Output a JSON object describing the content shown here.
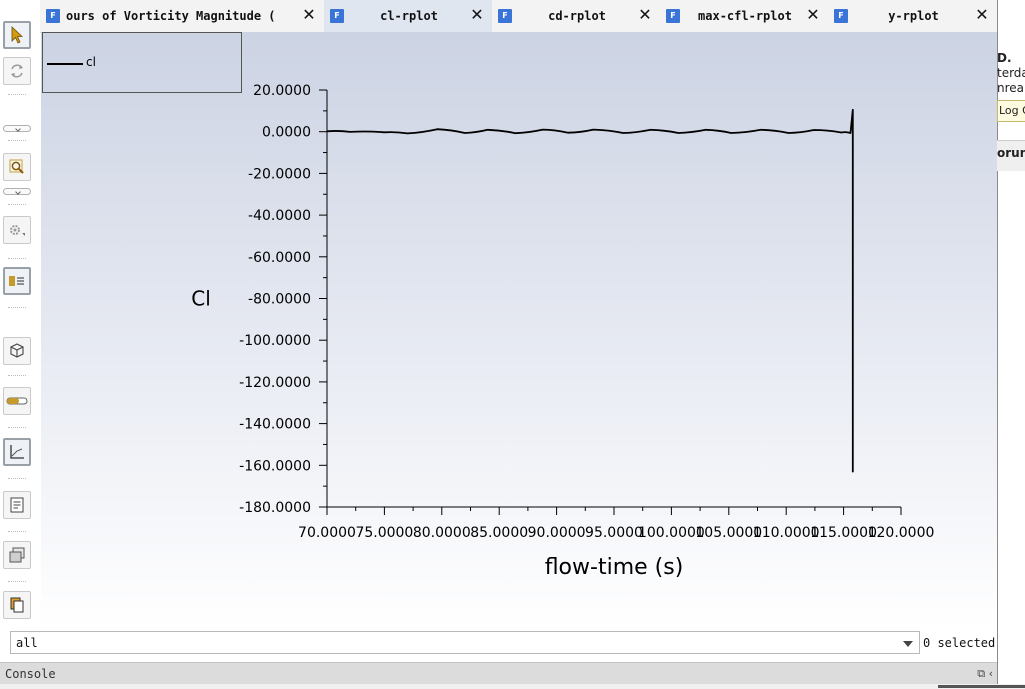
{
  "tabs": [
    {
      "label": "ours of Vorticity Magnitude (",
      "icon": "fluent-file-icon",
      "active": false
    },
    {
      "label": "cl-rplot",
      "icon": "fluent-file-icon",
      "active": true
    },
    {
      "label": "cd-rplot",
      "icon": "fluent-file-icon",
      "active": false
    },
    {
      "label": "max-cfl-rplot",
      "icon": "fluent-file-icon",
      "active": false
    },
    {
      "label": "y-rplot",
      "icon": "fluent-file-icon",
      "active": false
    }
  ],
  "tab_icon_letter": "F",
  "close_glyph": "✕",
  "toolbar": [
    "pointer-icon",
    "rotate-icon",
    "zoom-icon",
    "settings-icon",
    "legend-icon",
    "cube-icon",
    "slider-icon",
    "axes-icon",
    "report-icon",
    "view-icon",
    "copy-icon"
  ],
  "legend": {
    "label": "cl"
  },
  "chart_data": {
    "type": "line",
    "xlabel": "flow-time (s)",
    "ylabel": "Cl",
    "xlim": [
      70,
      120
    ],
    "ylim": [
      -180,
      20
    ],
    "x_ticks": [
      "70.0000",
      "75.0000",
      "80.0000",
      "85.0000",
      "90.0000",
      "95.0000",
      "100.0000",
      "105.0000",
      "110.0000",
      "115.0000",
      "120.0000"
    ],
    "y_ticks": [
      "20.0000",
      "0.0000",
      "-20.0000",
      "-40.0000",
      "-60.0000",
      "-80.0000",
      "-100.0000",
      "-120.0000",
      "-140.0000",
      "-160.0000",
      "-180.0000"
    ],
    "series": [
      {
        "name": "cl",
        "color": "#000000",
        "x": [
          70,
          72,
          75,
          77,
          79.6,
          82,
          84,
          86.4,
          88.8,
          91,
          93.2,
          95.8,
          98.2,
          100.6,
          103,
          105.2,
          107.8,
          110.2,
          112.4,
          114.8,
          115.6,
          115.8,
          115.8,
          115.8
        ],
        "y": [
          0.2,
          -0.1,
          -0.3,
          -0.8,
          1.2,
          -0.6,
          0.9,
          -0.7,
          1.0,
          -0.5,
          1.0,
          -0.6,
          0.9,
          -0.6,
          0.9,
          -0.6,
          0.9,
          -0.6,
          0.8,
          -0.4,
          -0.6,
          10.5,
          -163,
          -0.5
        ]
      }
    ]
  },
  "right_panel": {
    "lines": [
      "D.",
      "terda",
      "nrea",
      "orun"
    ],
    "log_label": "Log O"
  },
  "filter": {
    "value": "all",
    "selected": "0 selected"
  },
  "console": {
    "label": "Console",
    "icons": "⧉ ‹"
  }
}
